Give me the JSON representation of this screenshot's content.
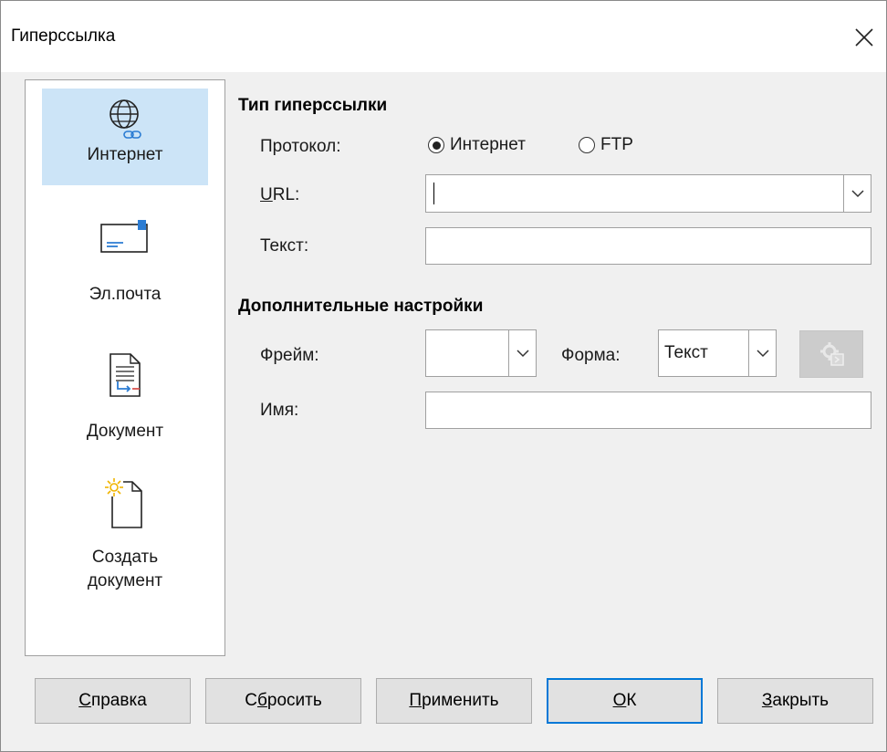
{
  "window": {
    "title": "Гиперссылка"
  },
  "sidebar": {
    "items": [
      {
        "label": "Интернет",
        "icon": "globe-link-icon",
        "selected": true
      },
      {
        "label": "Эл.почта",
        "icon": "envelope-icon",
        "selected": false
      },
      {
        "label": "Документ",
        "icon": "document-icon",
        "selected": false
      },
      {
        "label_line1": "Создать",
        "label_line2": "документ",
        "icon": "new-document-icon",
        "selected": false
      }
    ]
  },
  "hyperlink_type": {
    "heading": "Тип гиперссылки",
    "protocol_label": "Протокол:",
    "protocol_options": [
      {
        "label": "Интернет",
        "checked": true
      },
      {
        "label": "FTP",
        "checked": false
      }
    ],
    "url_label_u": "U",
    "url_label_rest": "RL:",
    "url_value": "",
    "text_label": "Текст:",
    "text_value": ""
  },
  "advanced": {
    "heading": "Дополнительные настройки",
    "frame_label": "Фрейм:",
    "frame_value": "",
    "form_label": "Форма:",
    "form_value": "Текст",
    "name_label": "Имя:",
    "name_value": ""
  },
  "buttons": {
    "help": {
      "u": "С",
      "rest": "правка"
    },
    "reset": {
      "pre": "С",
      "u": "б",
      "rest": "росить"
    },
    "apply": {
      "u": "П",
      "rest": "рименить"
    },
    "ok": {
      "u": "О",
      "rest": "К"
    },
    "close": {
      "u": "З",
      "rest": "акрыть"
    }
  },
  "colors": {
    "selected_bg": "#cce4f7",
    "accent": "#0078d7",
    "icon_blue": "#2b7cd3",
    "icon_red": "#d9534f",
    "icon_yellow": "#f0b400"
  }
}
